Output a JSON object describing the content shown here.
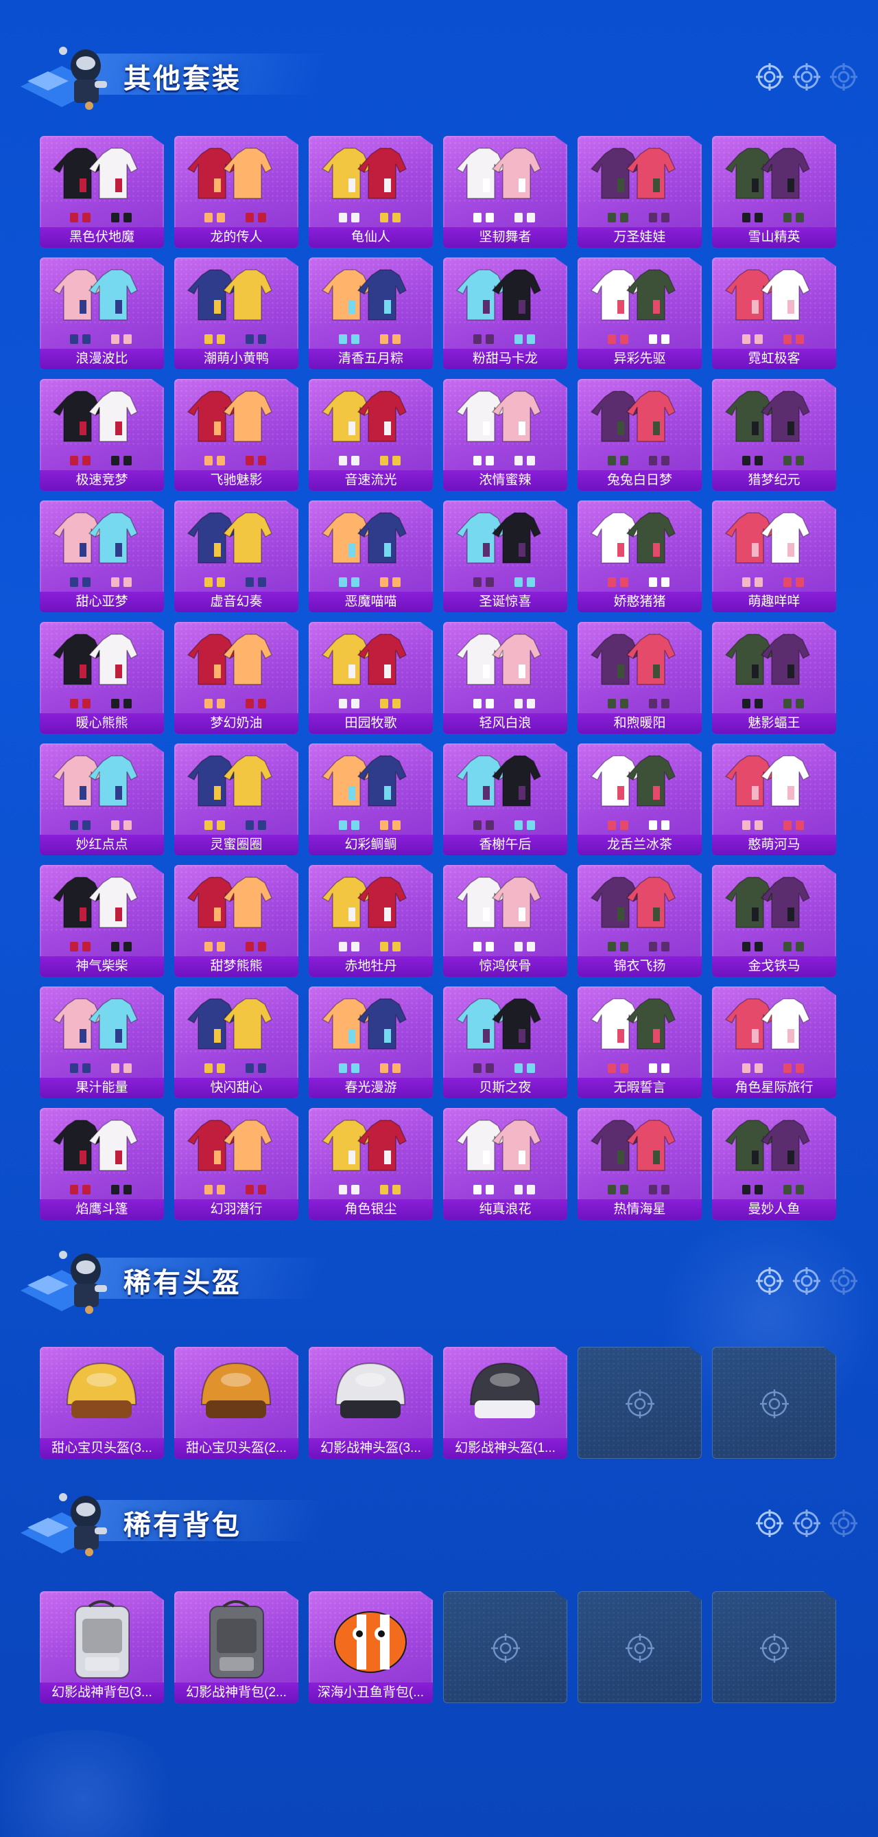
{
  "colors": {
    "background": "#0b4fd0",
    "card_purple": "#a348e0",
    "label_purple": "#7b16cc",
    "empty_slot": "#274a7c"
  },
  "sections": [
    {
      "title": "其他套装",
      "items": [
        {
          "name": "黑色伏地魔",
          "icon": "outfit-icon"
        },
        {
          "name": "龙的传人",
          "icon": "outfit-icon"
        },
        {
          "name": "龟仙人",
          "icon": "outfit-icon"
        },
        {
          "name": "坚韧舞者",
          "icon": "outfit-icon"
        },
        {
          "name": "万圣娃娃",
          "icon": "outfit-icon"
        },
        {
          "name": "雪山精英",
          "icon": "outfit-icon"
        },
        {
          "name": "浪漫波比",
          "icon": "outfit-icon"
        },
        {
          "name": "潮萌小黄鸭",
          "icon": "outfit-icon"
        },
        {
          "name": "清香五月粽",
          "icon": "outfit-icon"
        },
        {
          "name": "粉甜马卡龙",
          "icon": "outfit-icon"
        },
        {
          "name": "异彩先驱",
          "icon": "outfit-icon"
        },
        {
          "name": "霓虹极客",
          "icon": "outfit-icon"
        },
        {
          "name": "极速竞梦",
          "icon": "outfit-icon"
        },
        {
          "name": "飞驰魅影",
          "icon": "outfit-icon"
        },
        {
          "name": "音速流光",
          "icon": "outfit-icon"
        },
        {
          "name": "浓情蜜辣",
          "icon": "outfit-icon"
        },
        {
          "name": "兔兔白日梦",
          "icon": "outfit-icon"
        },
        {
          "name": "猎梦纪元",
          "icon": "outfit-icon"
        },
        {
          "name": "甜心亚梦",
          "icon": "outfit-icon"
        },
        {
          "name": "虚音幻奏",
          "icon": "outfit-icon"
        },
        {
          "name": "恶魔喵喵",
          "icon": "outfit-icon"
        },
        {
          "name": "圣诞惊喜",
          "icon": "outfit-icon"
        },
        {
          "name": "娇憨猪猪",
          "icon": "outfit-icon"
        },
        {
          "name": "萌趣咩咩",
          "icon": "outfit-icon"
        },
        {
          "name": "暖心熊熊",
          "icon": "outfit-icon"
        },
        {
          "name": "梦幻奶油",
          "icon": "outfit-icon"
        },
        {
          "name": "田园牧歌",
          "icon": "outfit-icon"
        },
        {
          "name": "轻风白浪",
          "icon": "outfit-icon"
        },
        {
          "name": "和煦暖阳",
          "icon": "outfit-icon"
        },
        {
          "name": "魅影蝠王",
          "icon": "outfit-icon"
        },
        {
          "name": "妙红点点",
          "icon": "outfit-icon"
        },
        {
          "name": "灵蜜圈圈",
          "icon": "outfit-icon"
        },
        {
          "name": "幻彩鲷鲷",
          "icon": "outfit-icon"
        },
        {
          "name": "香榭午后",
          "icon": "outfit-icon"
        },
        {
          "name": "龙舌兰冰茶",
          "icon": "outfit-icon"
        },
        {
          "name": "憨萌河马",
          "icon": "outfit-icon"
        },
        {
          "name": "神气柴柴",
          "icon": "outfit-icon"
        },
        {
          "name": "甜梦熊熊",
          "icon": "outfit-icon"
        },
        {
          "name": "赤地牡丹",
          "icon": "outfit-icon"
        },
        {
          "name": "惊鸿侠骨",
          "icon": "outfit-icon"
        },
        {
          "name": "锦衣飞扬",
          "icon": "outfit-icon"
        },
        {
          "name": "金戈铁马",
          "icon": "outfit-icon"
        },
        {
          "name": "果汁能量",
          "icon": "outfit-icon"
        },
        {
          "name": "快闪甜心",
          "icon": "outfit-icon"
        },
        {
          "name": "春光漫游",
          "icon": "outfit-icon"
        },
        {
          "name": "贝斯之夜",
          "icon": "outfit-icon"
        },
        {
          "name": "无暇誓言",
          "icon": "outfit-icon"
        },
        {
          "name": "角色星际旅行",
          "icon": "outfit-icon"
        },
        {
          "name": "焰鹰斗篷",
          "icon": "outfit-icon"
        },
        {
          "name": "幻羽潜行",
          "icon": "outfit-icon"
        },
        {
          "name": "角色银尘",
          "icon": "outfit-icon"
        },
        {
          "name": "纯真浪花",
          "icon": "outfit-icon"
        },
        {
          "name": "热情海星",
          "icon": "outfit-icon"
        },
        {
          "name": "曼妙人鱼",
          "icon": "outfit-icon"
        }
      ]
    },
    {
      "title": "稀有头盔",
      "items": [
        {
          "name": "甜心宝贝头盔(3...",
          "icon": "helmet-icon"
        },
        {
          "name": "甜心宝贝头盔(2...",
          "icon": "helmet-icon"
        },
        {
          "name": "幻影战神头盔(3...",
          "icon": "helmet-icon"
        },
        {
          "name": "幻影战神头盔(1...",
          "icon": "helmet-icon"
        }
      ],
      "empty_slots": 2
    },
    {
      "title": "稀有背包",
      "items": [
        {
          "name": "幻影战神背包(3...",
          "icon": "backpack-icon"
        },
        {
          "name": "幻影战神背包(2...",
          "icon": "backpack-icon"
        },
        {
          "name": "深海小丑鱼背包(...",
          "icon": "backpack-icon"
        }
      ],
      "empty_slots": 3
    }
  ]
}
